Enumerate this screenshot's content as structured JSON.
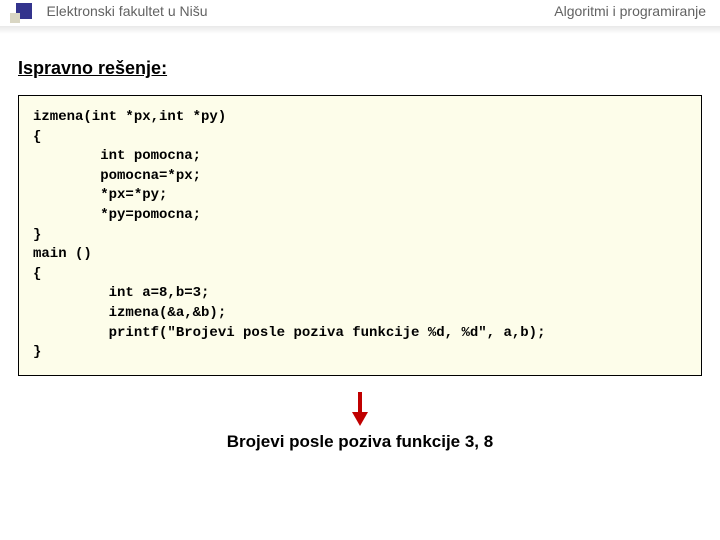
{
  "header": {
    "left": "Elektronski fakultet u Nišu",
    "right": "Algoritmi i programiranje"
  },
  "section_title": "Ispravno rešenje:",
  "code_lines": "izmena(int *px,int *py)\n{\n        int pomocna;\n        pomocna=*px;\n        *px=*py;\n        *py=pomocna;\n}\nmain ()\n{\n         int a=8,b=3;\n         izmena(&a,&b);\n         printf(\"Brojevi posle poziva funkcije %d, %d\", a,b);\n}",
  "output": "Brojevi posle poziva funkcije 3, 8",
  "colors": {
    "accent_square": "#33348d",
    "arrow": "#c00000",
    "code_bg": "#fdfdea"
  }
}
